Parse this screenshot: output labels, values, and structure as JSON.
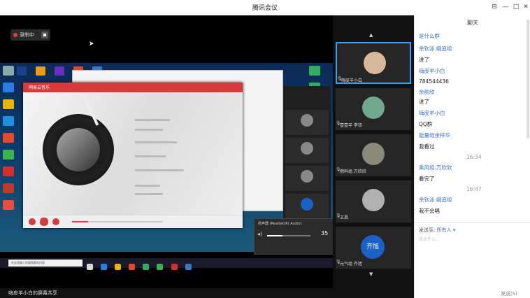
{
  "app": {
    "title": "腾讯会议"
  },
  "window_controls": {
    "pin": "⊟",
    "minimize": "—",
    "maximize": "□",
    "close": "✕"
  },
  "chat": {
    "title": "聊天",
    "messages": [
      {
        "kind": "name",
        "text": "是什么群"
      },
      {
        "kind": "name",
        "text": "余钦泳  峨追组"
      },
      {
        "kind": "msg",
        "text": "进了"
      },
      {
        "kind": "name",
        "text": "嗨皮羊小白"
      },
      {
        "kind": "msg",
        "text": "784544436"
      },
      {
        "kind": "name",
        "text": "余韵欣"
      },
      {
        "kind": "msg",
        "text": "进了"
      },
      {
        "kind": "name",
        "text": "嗨皮羊小白"
      },
      {
        "kind": "msg",
        "text": "QQ群"
      },
      {
        "kind": "name",
        "text": "能量组余梓华"
      },
      {
        "kind": "msg",
        "text": "我看过"
      },
      {
        "kind": "time",
        "text": "16:34"
      },
      {
        "kind": "name",
        "text": "乘风组.万欣欣"
      },
      {
        "kind": "msg",
        "text": "看完了"
      },
      {
        "kind": "time",
        "text": "16:47"
      },
      {
        "kind": "name",
        "text": "余钦泳  峨追组"
      },
      {
        "kind": "msg",
        "text": "我不会唱"
      }
    ],
    "send_to_label": "发送至:",
    "send_to_value": "所有人 ▾",
    "input_placeholder": "说点什么...",
    "send_button": "发送(S)"
  },
  "recording": {
    "label": "录制中"
  },
  "share_status": "嗨皮羊小白的屏幕共享",
  "participants": [
    {
      "name": "嗨皮羊小白",
      "initials": "",
      "active": true
    },
    {
      "name": "壹壹羊 李钰",
      "initials": ""
    },
    {
      "name": "燃料组.万欣欣",
      "initials": ""
    },
    {
      "name": "王昌",
      "initials": ""
    },
    {
      "name": "元气组 齐旭",
      "initials": "齐旭"
    }
  ],
  "screen": {
    "music_app_name": "网易云音乐",
    "taskbar_search": "在这里输入你要搜索的内容",
    "volume_label": "扬声器 (Realtek(R) Audio)",
    "volume_value": "35",
    "volume_fraction": 0.35,
    "playback_fraction": 0.18
  },
  "colors": {
    "accent": "#3b6cc6",
    "record": "#e04040",
    "music_red": "#d63c3c",
    "avatar_blue": "#1a62c8"
  }
}
